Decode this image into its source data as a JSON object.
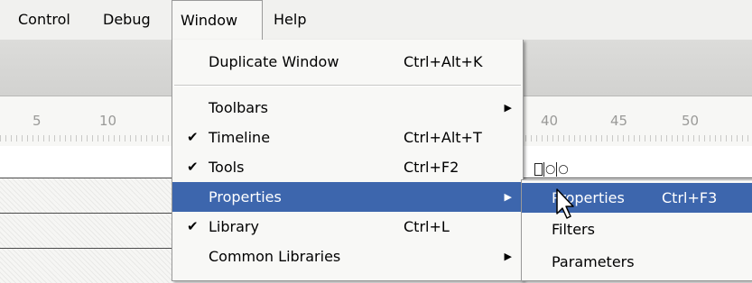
{
  "menubar": {
    "items": [
      {
        "label": "Control"
      },
      {
        "label": "Debug"
      },
      {
        "label": "Window"
      },
      {
        "label": "Help"
      }
    ]
  },
  "ruler": {
    "left_ticks": [
      "5",
      "10"
    ],
    "right_ticks": [
      "40",
      "45",
      "50"
    ]
  },
  "window_menu": {
    "duplicate": {
      "label": "Duplicate Window",
      "shortcut": "Ctrl+Alt+K"
    },
    "toolbars": {
      "label": "Toolbars"
    },
    "timeline": {
      "label": "Timeline",
      "shortcut": "Ctrl+Alt+T",
      "checked": true
    },
    "tools": {
      "label": "Tools",
      "shortcut": "Ctrl+F2",
      "checked": true
    },
    "properties": {
      "label": "Properties"
    },
    "library": {
      "label": "Library",
      "shortcut": "Ctrl+L",
      "checked": true
    },
    "common_libraries": {
      "label": "Common Libraries"
    }
  },
  "properties_submenu": {
    "properties": {
      "label": "Properties",
      "shortcut": "Ctrl+F3"
    },
    "filters": {
      "label": "Filters"
    },
    "parameters": {
      "label": "Parameters"
    }
  },
  "glyphs": {
    "check": "✔",
    "arrow": "▶"
  },
  "colors": {
    "highlight": "#3d66ad",
    "menu_bg": "#f8f8f6"
  }
}
